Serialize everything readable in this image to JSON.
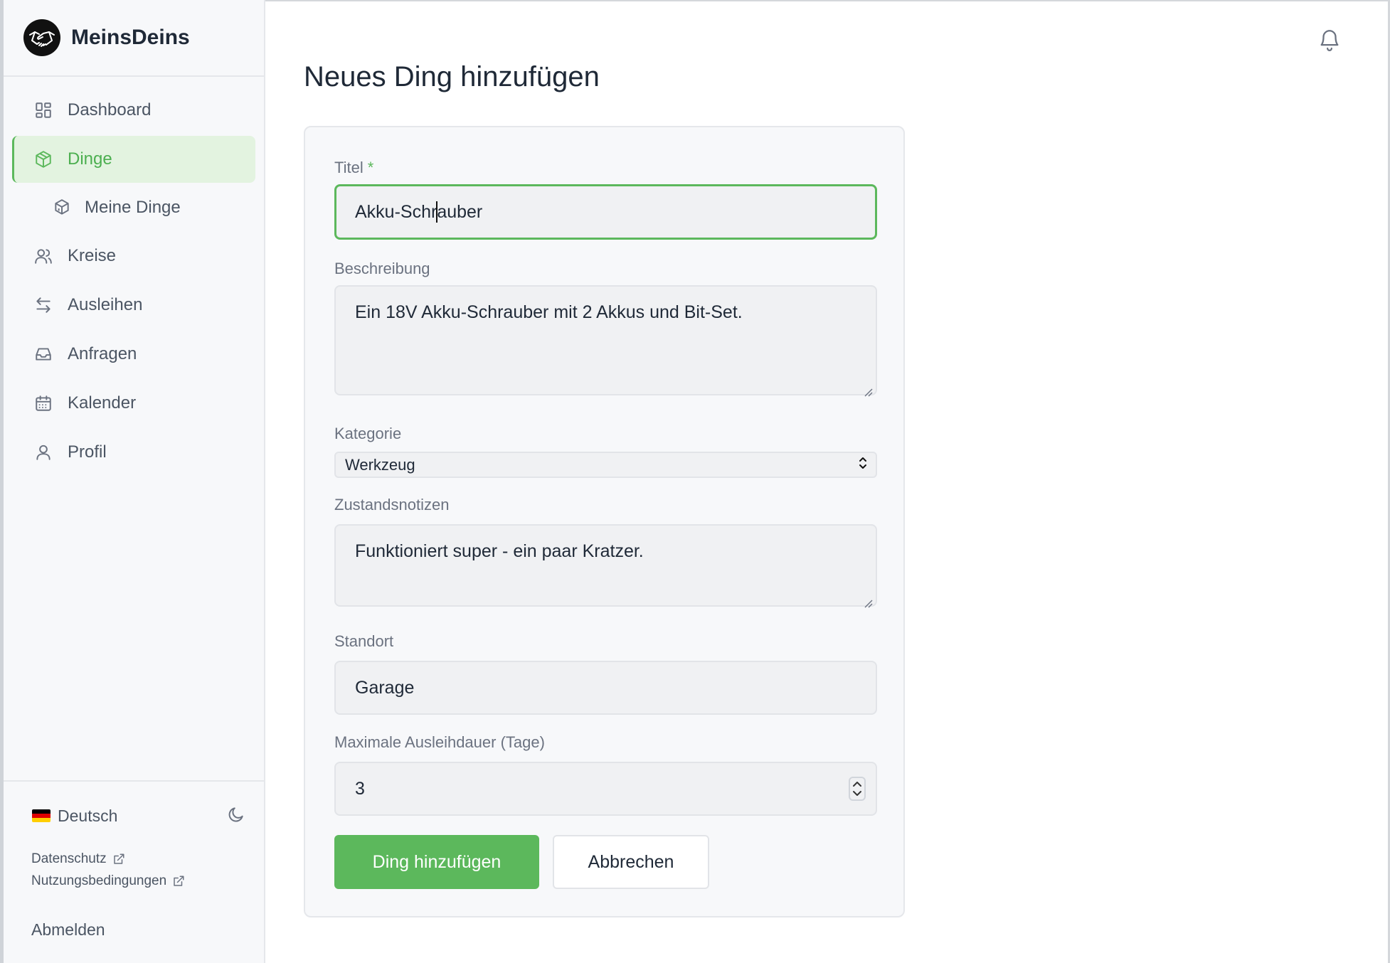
{
  "app": {
    "name": "MeinsDeins"
  },
  "sidebar": {
    "items": [
      {
        "label": "Dashboard",
        "icon": "dashboard-icon"
      },
      {
        "label": "Dinge",
        "icon": "box-icon",
        "active": true
      },
      {
        "label": "Meine Dinge",
        "icon": "boxes-icon",
        "sub": true
      },
      {
        "label": "Kreise",
        "icon": "users-icon"
      },
      {
        "label": "Ausleihen",
        "icon": "swap-arrows-icon"
      },
      {
        "label": "Anfragen",
        "icon": "inbox-icon"
      },
      {
        "label": "Kalender",
        "icon": "calendar-icon"
      },
      {
        "label": "Profil",
        "icon": "user-icon"
      }
    ],
    "footer": {
      "language": "Deutsch",
      "privacy": "Datenschutz",
      "terms": "Nutzungsbedingungen",
      "logout": "Abmelden"
    }
  },
  "main": {
    "title": "Neues Ding hinzufügen",
    "form": {
      "title_label": "Titel",
      "required_mark": "*",
      "title_value_before_caret": "Akku-Schr",
      "title_value_after_caret": "auber",
      "description_label": "Beschreibung",
      "description_value": "Ein 18V Akku-Schrauber mit 2 Akkus und Bit-Set.",
      "category_label": "Kategorie",
      "category_value": "Werkzeug",
      "condition_label": "Zustandsnotizen",
      "condition_value": "Funktioniert super - ein paar Kratzer.",
      "location_label": "Standort",
      "location_value": "Garage",
      "max_days_label": "Maximale Ausleihdauer (Tage)",
      "max_days_value": "3",
      "submit_label": "Ding hinzufügen",
      "cancel_label": "Abbrechen"
    }
  },
  "colors": {
    "accent": "#5cb85c",
    "active_bg": "#e3f3e0",
    "sidebar_bg": "#f7f8fa",
    "text": "#1f2937",
    "muted": "#6b7280"
  }
}
